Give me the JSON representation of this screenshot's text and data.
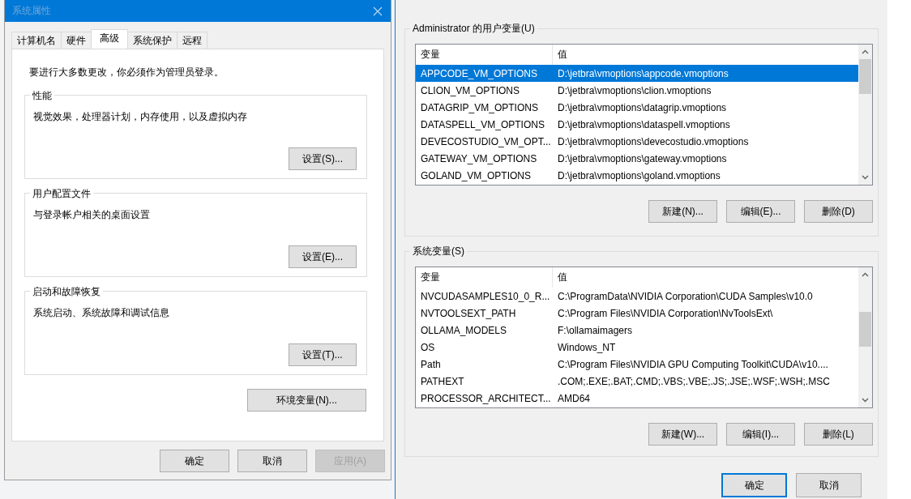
{
  "system_properties": {
    "title": "系统属性",
    "tabs": [
      {
        "label": "计算机名",
        "selected": false
      },
      {
        "label": "硬件",
        "selected": false
      },
      {
        "label": "高级",
        "selected": true
      },
      {
        "label": "系统保护",
        "selected": false
      },
      {
        "label": "远程",
        "selected": false
      }
    ],
    "notice": "要进行大多数更改，你必须作为管理员登录。",
    "groups": [
      {
        "title": "性能",
        "description": "视觉效果，处理器计划，内存使用，以及虚拟内存",
        "button": "设置(S)..."
      },
      {
        "title": "用户配置文件",
        "description": "与登录帐户相关的桌面设置",
        "button": "设置(E)..."
      },
      {
        "title": "启动和故障恢复",
        "description": "系统启动、系统故障和调试信息",
        "button": "设置(T)..."
      }
    ],
    "env_button": "环境变量(N)...",
    "buttons": [
      {
        "label": "确定",
        "disabled": false
      },
      {
        "label": "取消",
        "disabled": false
      },
      {
        "label": "应用(A)",
        "disabled": true
      }
    ]
  },
  "environment_variables": {
    "sections": [
      {
        "title": "Administrator 的用户变量(U)",
        "columns": [
          "变量",
          "值"
        ],
        "rows": [
          {
            "name": "APPCODE_VM_OPTIONS",
            "value": "D:\\jetbra\\vmoptions\\appcode.vmoptions",
            "selected": true
          },
          {
            "name": "CLION_VM_OPTIONS",
            "value": "D:\\jetbra\\vmoptions\\clion.vmoptions",
            "selected": false
          },
          {
            "name": "DATAGRIP_VM_OPTIONS",
            "value": "D:\\jetbra\\vmoptions\\datagrip.vmoptions",
            "selected": false
          },
          {
            "name": "DATASPELL_VM_OPTIONS",
            "value": "D:\\jetbra\\vmoptions\\dataspell.vmoptions",
            "selected": false
          },
          {
            "name": "DEVECOSTUDIO_VM_OPT...",
            "value": "D:\\jetbra\\vmoptions\\devecostudio.vmoptions",
            "selected": false
          },
          {
            "name": "GATEWAY_VM_OPTIONS",
            "value": "D:\\jetbra\\vmoptions\\gateway.vmoptions",
            "selected": false
          },
          {
            "name": "GOLAND_VM_OPTIONS",
            "value": "D:\\jetbra\\vmoptions\\goland.vmoptions",
            "selected": false
          }
        ],
        "buttons": [
          "新建(N)...",
          "编辑(E)...",
          "删除(D)"
        ]
      },
      {
        "title": "系统变量(S)",
        "columns": [
          "变量",
          "值"
        ],
        "rows": [
          {
            "name": "NVCUDASAMPLES10_0_R...",
            "value": "C:\\ProgramData\\NVIDIA Corporation\\CUDA Samples\\v10.0",
            "selected": false
          },
          {
            "name": "NVTOOLSEXT_PATH",
            "value": "C:\\Program Files\\NVIDIA Corporation\\NvToolsExt\\",
            "selected": false
          },
          {
            "name": "OLLAMA_MODELS",
            "value": "F:\\ollamaimagers",
            "selected": false
          },
          {
            "name": "OS",
            "value": "Windows_NT",
            "selected": false
          },
          {
            "name": "Path",
            "value": "C:\\Program Files\\NVIDIA GPU Computing Toolkit\\CUDA\\v10....",
            "selected": false
          },
          {
            "name": "PATHEXT",
            "value": ".COM;.EXE;.BAT;.CMD;.VBS;.VBE;.JS;.JSE;.WSF;.WSH;.MSC",
            "selected": false
          },
          {
            "name": "PROCESSOR_ARCHITECT...",
            "value": "AMD64",
            "selected": false
          }
        ],
        "buttons": [
          "新建(W)...",
          "编辑(I)...",
          "删除(L)"
        ]
      }
    ],
    "buttons": [
      {
        "label": "确定",
        "default": true
      },
      {
        "label": "取消",
        "default": false
      }
    ]
  }
}
